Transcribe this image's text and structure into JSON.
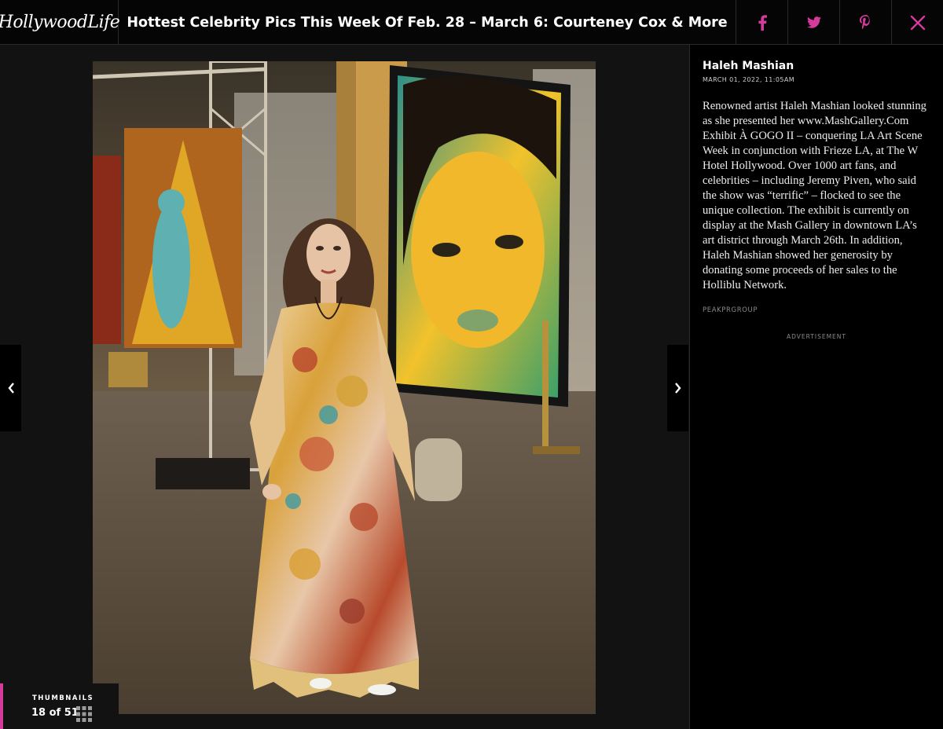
{
  "header": {
    "logo": "HollywoodLife",
    "title": "Hottest Celebrity Pics This Week Of Feb. 28 – March 6: Courteney Cox & More",
    "share": {
      "facebook_icon": "facebook-icon",
      "twitter_icon": "twitter-icon",
      "pinterest_icon": "pinterest-icon",
      "close_icon": "close-icon"
    },
    "accent_color": "#d63a9b"
  },
  "gallery": {
    "photo_alt": "Haleh Mashian posing in front of artwork",
    "prev_icon": "chevron-left-icon",
    "next_icon": "chevron-right-icon",
    "thumbnails_label": "THUMBNAILS",
    "position": "18 of 51",
    "grid_icon": "grid-icon"
  },
  "sidebar": {
    "name": "Haleh Mashian",
    "date": "MARCH 01, 2022, 11:05AM",
    "caption": "Renowned artist Haleh Mashian looked stunning as she presented her www.MashGallery.Com Exhibit À GOGO II – conquering LA Art Scene Week in conjunction with Frieze LA, at The W Hotel Hollywood. Over 1000 art fans, and celebrities – including Jeremy Piven, who said the show was “terrific” – flocked to see the unique collection. The exhibit is currently on display at the Mash Gallery in downtown LA’s art district through March 26th. In addition, Haleh Mashian showed her generosity by donating some proceeds of her sales to the Holliblu Network.",
    "source": "PEAKPRGROUP",
    "advertisement": "ADVERTISEMENT"
  }
}
